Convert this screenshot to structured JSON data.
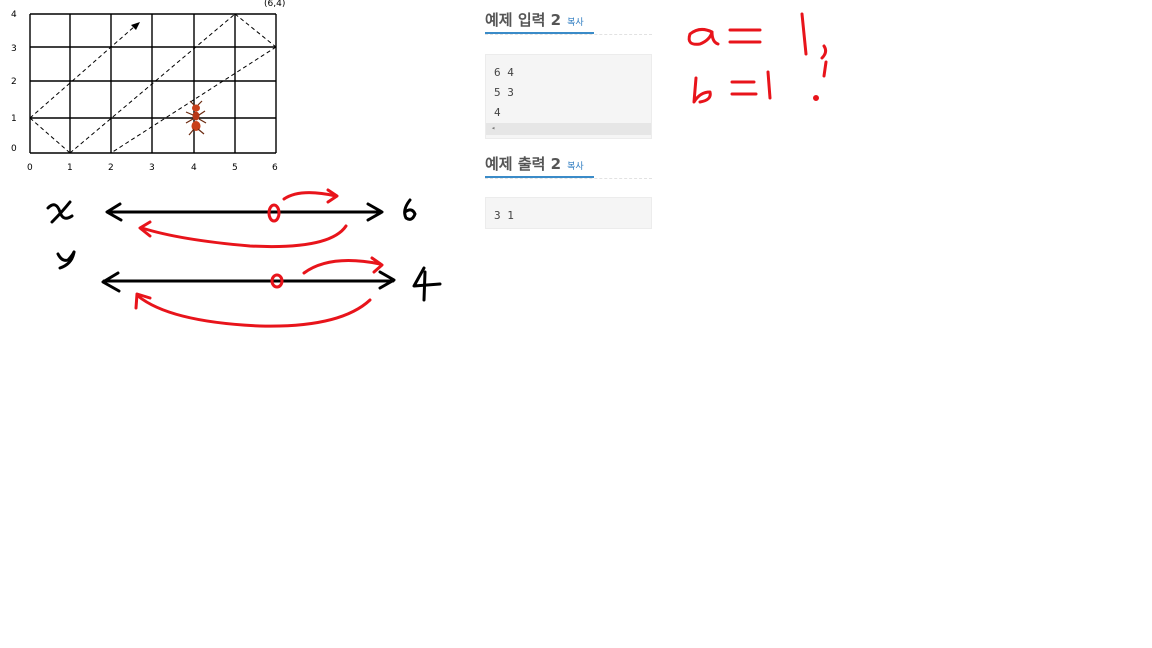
{
  "grid_chart": {
    "x_ticks": [
      "0",
      "1",
      "2",
      "3",
      "4",
      "5",
      "6"
    ],
    "y_ticks": [
      "0",
      "1",
      "2",
      "3",
      "4"
    ],
    "corner_label": "(6,4)"
  },
  "sample_input": {
    "title": "예제 입력 2",
    "copy_label": "복사",
    "lines": [
      "6 4",
      "5 3",
      "4"
    ]
  },
  "sample_output": {
    "title": "예제 출력 2",
    "copy_label": "복사",
    "lines": [
      "3 1"
    ]
  },
  "sketch": {
    "x_label": "x",
    "x_end": "6",
    "y_label": "y",
    "y_end": "4",
    "answer_line1": "a = 1,",
    "answer_line2": "b = 1",
    "answer_mark": "!",
    "ink_colors": {
      "black": "#000000",
      "red": "#e8141b"
    }
  }
}
